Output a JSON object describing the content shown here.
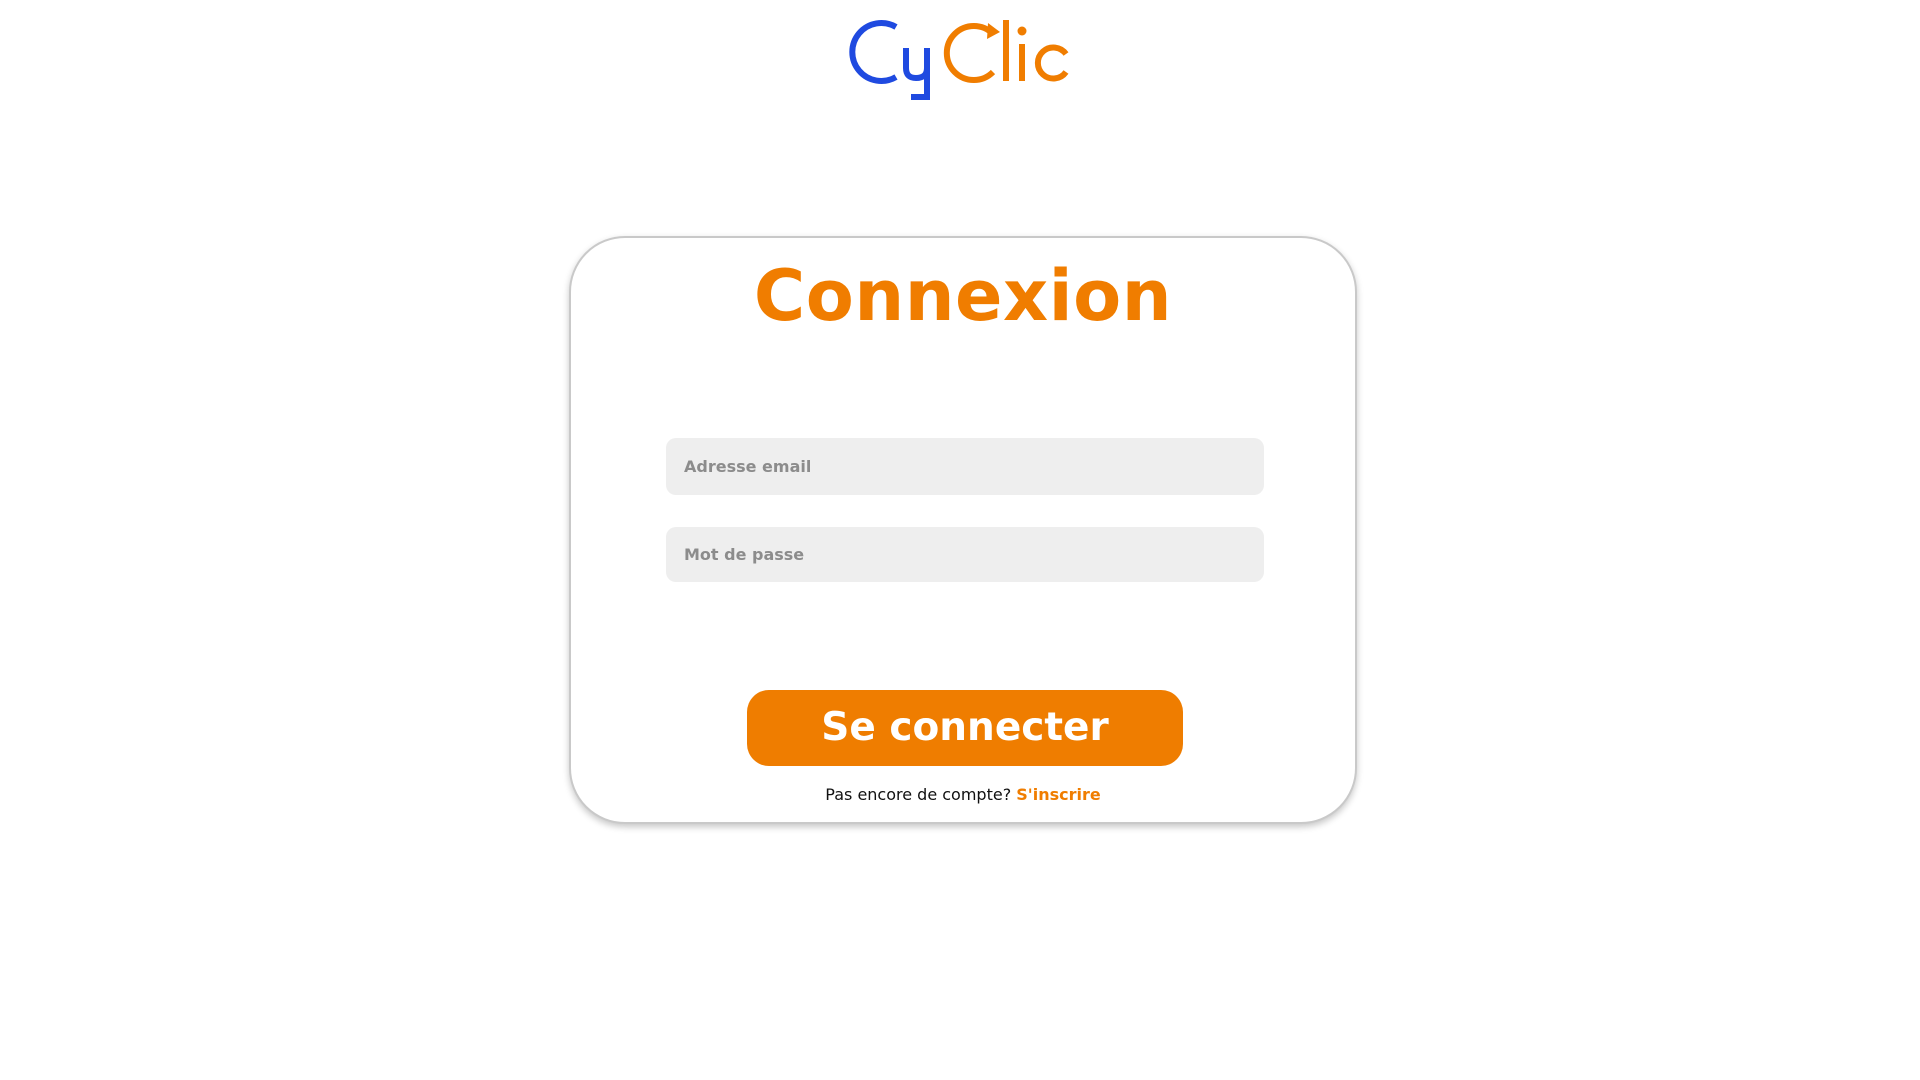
{
  "brand": {
    "logo_text": "CyClic",
    "color_primary_blue": "#1f4ae0",
    "color_accent_orange": "#f07d00"
  },
  "login_card": {
    "title": "Connexion",
    "email_placeholder": "Adresse email",
    "password_placeholder": "Mot de passe",
    "submit_label": "Se connecter",
    "signup_prompt": "Pas encore de compte?",
    "signup_link": "S'inscrire"
  }
}
